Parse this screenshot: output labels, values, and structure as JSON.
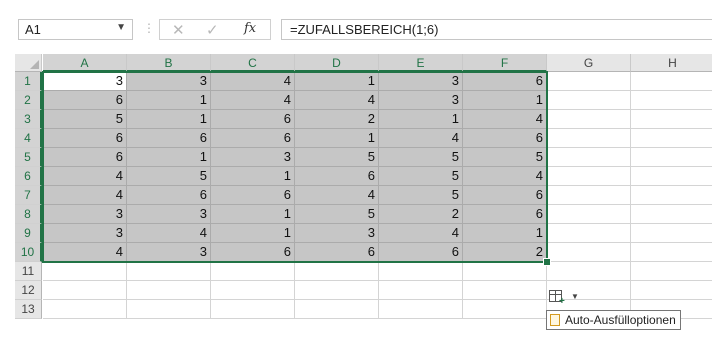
{
  "formula_bar": {
    "name_box": "A1",
    "cancel_glyph": "✕",
    "enter_glyph": "✓",
    "fx_label": "fx",
    "formula": "=ZUFALLSBEREICH(1;6)"
  },
  "columns": [
    "A",
    "B",
    "C",
    "D",
    "E",
    "F",
    "G",
    "H"
  ],
  "rows": [
    {
      "num": "1",
      "values": [
        "3",
        "3",
        "4",
        "1",
        "3",
        "6"
      ]
    },
    {
      "num": "2",
      "values": [
        "6",
        "1",
        "4",
        "4",
        "3",
        "1"
      ]
    },
    {
      "num": "3",
      "values": [
        "5",
        "1",
        "6",
        "2",
        "1",
        "4"
      ]
    },
    {
      "num": "4",
      "values": [
        "6",
        "6",
        "6",
        "1",
        "4",
        "6"
      ]
    },
    {
      "num": "5",
      "values": [
        "6",
        "1",
        "3",
        "5",
        "5",
        "5"
      ]
    },
    {
      "num": "6",
      "values": [
        "4",
        "5",
        "1",
        "6",
        "5",
        "4"
      ]
    },
    {
      "num": "7",
      "values": [
        "4",
        "6",
        "6",
        "4",
        "5",
        "6"
      ]
    },
    {
      "num": "8",
      "values": [
        "3",
        "3",
        "1",
        "5",
        "2",
        "6"
      ]
    },
    {
      "num": "9",
      "values": [
        "3",
        "4",
        "1",
        "3",
        "4",
        "1"
      ]
    },
    {
      "num": "10",
      "values": [
        "4",
        "3",
        "6",
        "6",
        "6",
        "2"
      ]
    },
    {
      "num": "11",
      "values": [
        "",
        "",
        "",
        "",
        "",
        ""
      ]
    },
    {
      "num": "12",
      "values": [
        "",
        "",
        "",
        "",
        "",
        ""
      ]
    },
    {
      "num": "13",
      "values": [
        "",
        "",
        "",
        "",
        "",
        ""
      ]
    }
  ],
  "autofill": {
    "tooltip": "Auto-Ausfülloptionen"
  },
  "colors": {
    "accent": "#217346",
    "selection_fill": "#c6c6c6",
    "header_fill": "#e6e6e6"
  }
}
